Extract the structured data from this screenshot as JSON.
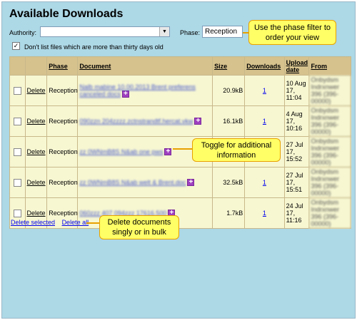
{
  "title": "Available Downloads",
  "filters": {
    "authority_label": "Authority:",
    "authority_value": "",
    "phase_label": "Phase:",
    "phase_value": "Reception",
    "exclude_old_checked": true,
    "exclude_old_label": "Don't list files which are more than thirty days old"
  },
  "table": {
    "headers": {
      "phase": "Phase",
      "document": "Document",
      "size": "Size",
      "downloads": "Downloads",
      "upload_date": "Upload date",
      "from": "From"
    },
    "rows": [
      {
        "delete": "Delete",
        "phase": "Reception",
        "doc": "Nalb mabine 10.00.2013 Brent preferens canceled docs",
        "size": "20.9kB",
        "downloads": "1",
        "date": "10 Aug 17, 11:04",
        "from": "Onbydsm Indrxnwer 396 (396-00000)"
      },
      {
        "delete": "Delete",
        "phase": "Reception",
        "doc": "090zzn 204zzzz.zctnstrandtf.hercat.vkw",
        "size": "16.1kB",
        "downloads": "1",
        "date": "4 Aug 17, 10:16",
        "from": "Onbydsm Indrxnwer 396 (396-00000)"
      },
      {
        "delete": "Delete",
        "phase": "Reception",
        "doc": "zz 0WNmB8S N&ab one pws",
        "size": "",
        "downloads": "",
        "date": "27 Jul 17, 15:52",
        "from": "Onbydsm Indrxnwer 396 (396-00000)"
      },
      {
        "delete": "Delete",
        "phase": "Reception",
        "doc": "zz 0WNmB8S N&ab welt & Brent.doc",
        "size": "32.5kB",
        "downloads": "1",
        "date": "27 Jul 17, 15:51",
        "from": "Onbydsm Indrxnwer 396 (396-00000)"
      },
      {
        "delete": "Delete",
        "phase": "Reception",
        "doc": "060zzz 407 094zzz 17616.500",
        "size": "1.7kB",
        "downloads": "1",
        "date": "24 Jul 17, 11:16",
        "from": "Onbydsm Indrxnwer 396 (396-00000)"
      }
    ]
  },
  "actions": {
    "delete_selected": "Delete selected",
    "delete_all": "Delete all"
  },
  "callouts": {
    "phase": "Use the phase filter to order your view",
    "toggle": "Toggle for additional information",
    "delete": "Delete documents singly or in bulk"
  },
  "icons": {
    "expand": "plus-toggle-icon",
    "dropdown": "chevron-down-icon",
    "checkbox": "check-icon"
  },
  "colors": {
    "background": "#add8e6",
    "header": "#d6c28d",
    "row": "#f7f7d2",
    "callout": "#ffff66",
    "toggle": "#a040c0"
  }
}
